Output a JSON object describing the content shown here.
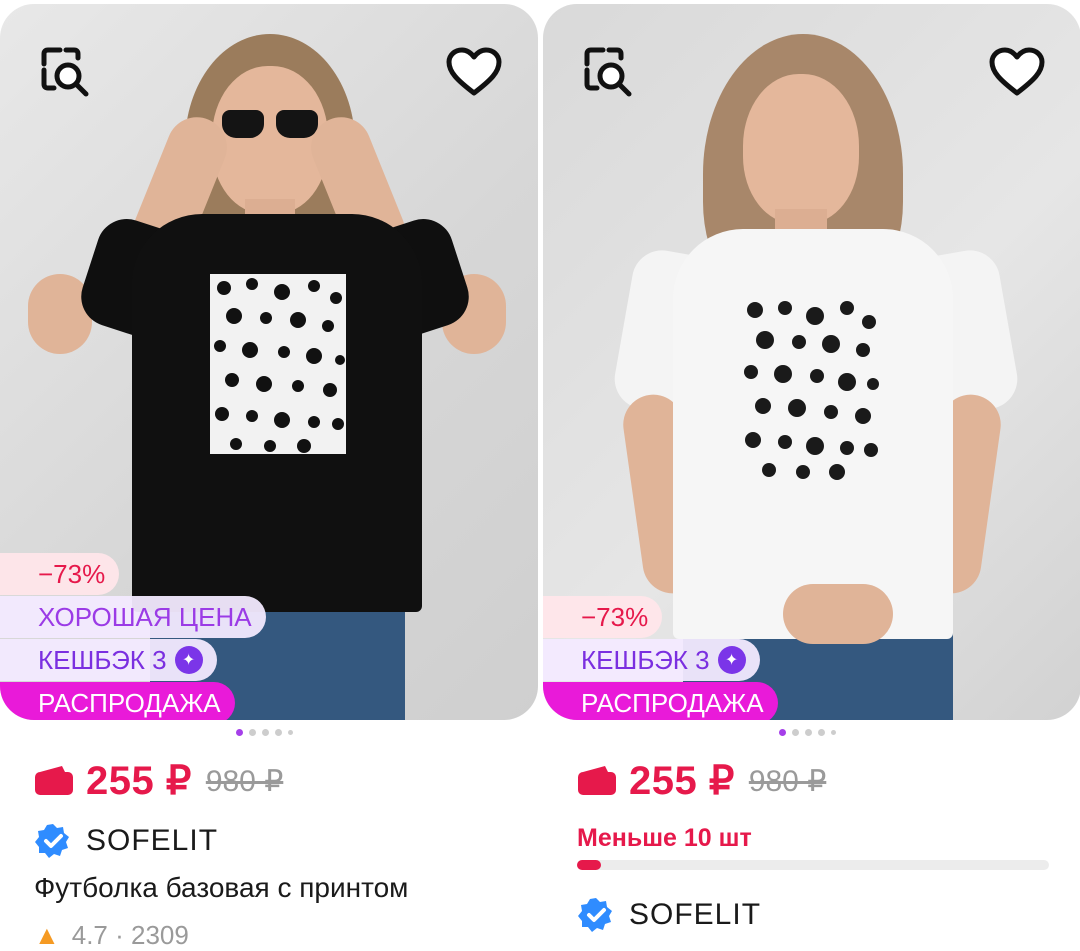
{
  "products": [
    {
      "discount": "−73%",
      "good_price": "ХОРОШАЯ ЦЕНА",
      "cashback": "КЕШБЭК 3",
      "sale": "РАСПРОДАЖА",
      "price": "255 ₽",
      "old_price": "980 ₽",
      "brand": "SOFELIT",
      "title": "Футболка базовая с принтом",
      "rating": "4.7",
      "reviews": "2309",
      "gallery_dots": 5,
      "active_dot": 0
    },
    {
      "discount": "−73%",
      "cashback": "КЕШБЭК 3",
      "sale": "РАСПРОДАЖА",
      "price": "255 ₽",
      "old_price": "980 ₽",
      "stock_text": "Меньше 10 шт",
      "stock_level": 0.05,
      "brand": "SOFELIT",
      "gallery_dots": 5,
      "active_dot": 0
    }
  ],
  "icons": {
    "image_search": "image-search-icon",
    "favorite": "heart-icon",
    "wallet": "wallet-icon",
    "verified": "verified-badge-icon",
    "cashback": "sparkle-icon",
    "rating": "star-icon"
  },
  "colors": {
    "price": "#e6194b",
    "sale_badge": "#e91ad9",
    "cashback": "#7b35e8",
    "verified": "#2f8cff"
  }
}
